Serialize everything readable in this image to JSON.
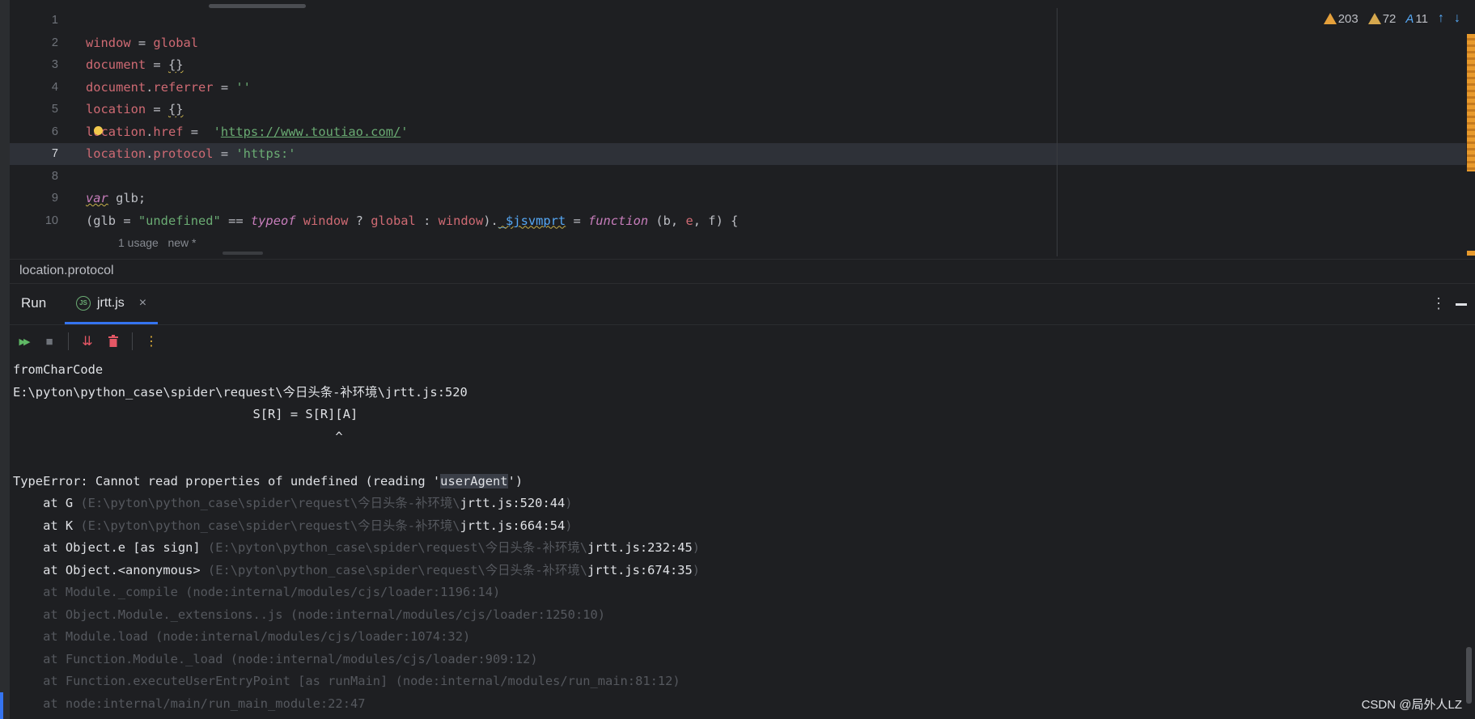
{
  "editor": {
    "line_numbers": [
      "1",
      "2",
      "3",
      "4",
      "5",
      "6",
      "7",
      "8",
      "9",
      "10"
    ],
    "current_line": "7",
    "code": {
      "l2": [
        "window",
        " = ",
        "global"
      ],
      "l3": [
        "document",
        " = ",
        "{}"
      ],
      "l4": [
        "document",
        ".",
        "referrer",
        " = ",
        "''"
      ],
      "l5": [
        "location",
        " = ",
        "{}"
      ],
      "l6": [
        "location",
        ".",
        "href",
        " =  ",
        "'",
        "https://www.toutiao.com/",
        "'"
      ],
      "l7": [
        "location",
        ".",
        "protocol",
        " = ",
        "'https:'"
      ],
      "l9": [
        "var",
        " glb;"
      ],
      "l10": [
        "(glb = ",
        "\"undefined\"",
        " == ",
        "typeof",
        " window",
        " ? ",
        "global",
        " : ",
        "window",
        ").",
        "_$jsvmprt",
        " = ",
        "function",
        " (b, ",
        "e",
        ", ",
        "f",
        ") {"
      ],
      "hint": "1 usage   new *"
    },
    "inspections": {
      "errors": "203",
      "warnings": "72",
      "typos": "11"
    }
  },
  "breadcrumb": "location.protocol",
  "run": {
    "title": "Run",
    "tab_label": "jrtt.js",
    "tab_icon": "JS",
    "close_glyph": "×",
    "menu_glyph": "⋮"
  },
  "toolbar": {
    "rerun": "▶▶",
    "stop": "■",
    "scroll": "⇊",
    "clear": "🗑",
    "more": "⋮"
  },
  "console": {
    "l1": "fromCharCode",
    "l2": "E:\\pyton\\python_case\\spider\\request\\今日头条-补环境\\jrtt.js:520",
    "l3": "                                S[R] = S[R][A]",
    "l4": "                                           ^",
    "l6a": "TypeError: Cannot read properties of undefined (reading '",
    "l6b": "userAgent",
    "l6c": "')",
    "stack": [
      {
        "at": "    at G ",
        "path": "(E:\\pyton\\python_case\\spider\\request\\今日头条-补环境\\",
        "file": "jrtt.js:520:44",
        "end": ")"
      },
      {
        "at": "    at K ",
        "path": "(E:\\pyton\\python_case\\spider\\request\\今日头条-补环境\\",
        "file": "jrtt.js:664:54",
        "end": ")"
      },
      {
        "at": "    at Object.e [as sign] ",
        "path": "(E:\\pyton\\python_case\\spider\\request\\今日头条-补环境\\",
        "file": "jrtt.js:232:45",
        "end": ")"
      },
      {
        "at": "    at Object.<anonymous> ",
        "path": "(E:\\pyton\\python_case\\spider\\request\\今日头条-补环境\\",
        "file": "jrtt.js:674:35",
        "end": ")"
      }
    ],
    "internal": [
      "    at Module._compile (node:internal/modules/cjs/loader:1196:14)",
      "    at Object.Module._extensions..js (node:internal/modules/cjs/loader:1250:10)",
      "    at Module.load (node:internal/modules/cjs/loader:1074:32)",
      "    at Function.Module._load (node:internal/modules/cjs/loader:909:12)",
      "    at Function.executeUserEntryPoint [as runMain] (node:internal/modules/run_main:81:12)",
      "    at node:internal/main/run_main_module:22:47"
    ]
  },
  "watermark": "CSDN @局外人LZ",
  "colors": {
    "accent": "#3574f0",
    "keyword": "#cf6a73",
    "string": "#6aab73",
    "warning": "#e5a03b"
  }
}
